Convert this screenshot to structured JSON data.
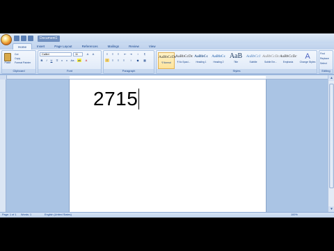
{
  "qat": {
    "doc_title": "Document1"
  },
  "tabs": [
    "Home",
    "Insert",
    "Page Layout",
    "References",
    "Mailings",
    "Review",
    "View"
  ],
  "clipboard": {
    "paste_label": "Paste",
    "cut": "Cut",
    "copy": "Copy",
    "format_painter": "Format Painter",
    "group_label": "Clipboard"
  },
  "font": {
    "name": "Calibri",
    "size": "11",
    "group_label": "Font"
  },
  "paragraph": {
    "group_label": "Paragraph"
  },
  "styles": {
    "group_label": "Styles",
    "items": [
      {
        "preview": "AaBbCcDc",
        "name": "¶ Normal"
      },
      {
        "preview": "AaBbCcDc",
        "name": "¶ No Spaci..."
      },
      {
        "preview": "AaBbCc",
        "name": "Heading 1"
      },
      {
        "preview": "AaBbCc",
        "name": "Heading 2"
      },
      {
        "preview": "AaB",
        "name": "Title"
      },
      {
        "preview": "AaBbCcI",
        "name": "Subtitle"
      },
      {
        "preview": "AaBbCcDc",
        "name": "Subtle Em..."
      },
      {
        "preview": "AaBbCcDc",
        "name": "Emphasis"
      }
    ],
    "change_styles": "Change Styles"
  },
  "editing": {
    "find": "Find",
    "replace": "Replace",
    "select": "Select",
    "group_label": "Editing"
  },
  "document": {
    "text": "2715"
  },
  "statusbar": {
    "page": "Page: 1 of 1",
    "words": "Words: 1",
    "language": "English (United States)",
    "zoom": "100%"
  }
}
